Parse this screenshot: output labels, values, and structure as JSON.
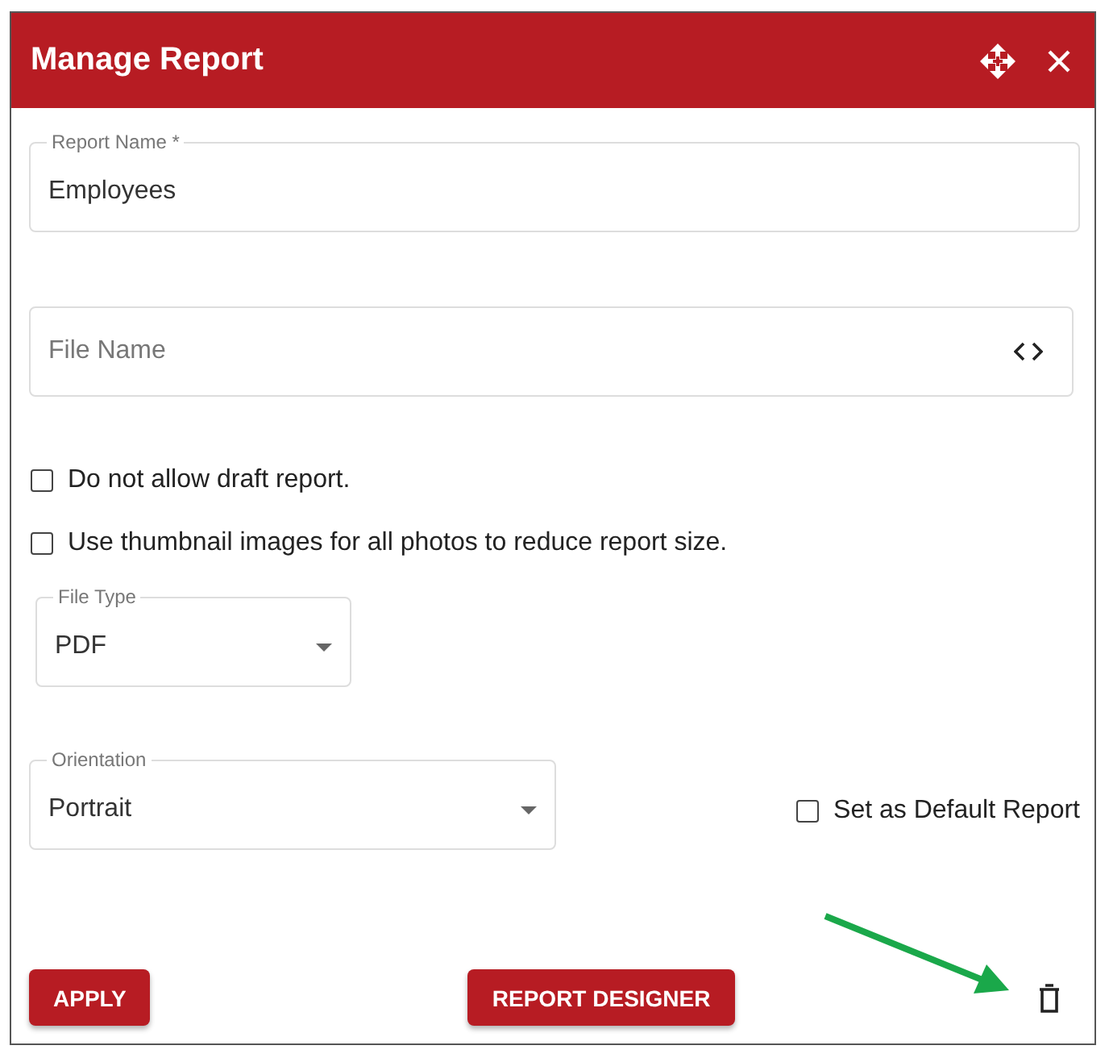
{
  "dialog": {
    "title": "Manage Report"
  },
  "report_name": {
    "label": "Report Name *",
    "value": "Employees"
  },
  "file_name": {
    "placeholder": "File Name"
  },
  "options": [
    {
      "label": "Do not allow draft report.",
      "checked": false
    },
    {
      "label": "Use thumbnail images for all photos to reduce report size.",
      "checked": false
    }
  ],
  "file_type": {
    "label": "File Type",
    "value": "PDF"
  },
  "orientation": {
    "label": "Orientation",
    "value": "Portrait"
  },
  "default_report": {
    "label": "Set as Default Report",
    "checked": false
  },
  "buttons": [
    "APPLY",
    "REPORT DESIGNER"
  ]
}
